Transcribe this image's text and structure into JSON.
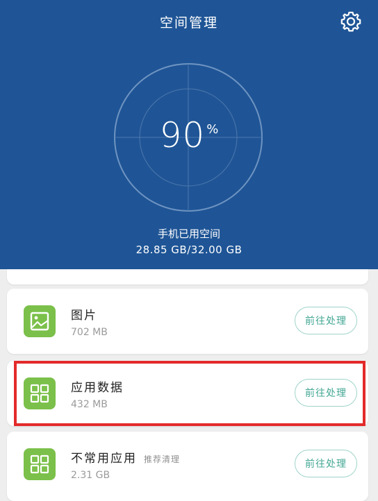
{
  "header": {
    "title": "空间管理",
    "gear_icon": "gear-icon",
    "usage_percent": 90,
    "usage_number": "90",
    "usage_symbol": "%",
    "used_label": "手机已用空间",
    "used_value": "28.85 GB/32.00 GB"
  },
  "items": [
    {
      "name": "图片",
      "size": "702 MB",
      "action": "前往处理",
      "icon": "image-icon"
    },
    {
      "name": "应用数据",
      "size": "432 MB",
      "action": "前往处理",
      "icon": "grid-icon"
    },
    {
      "name": "不常用应用",
      "tag": "推荐清理",
      "size": "2.31 GB",
      "action": "前往处理",
      "icon": "grid-icon"
    }
  ],
  "colors": {
    "header": "#1f5596",
    "accent_green": "#7bc04a",
    "button_text": "#43a794",
    "highlight": "#e32a2a"
  }
}
